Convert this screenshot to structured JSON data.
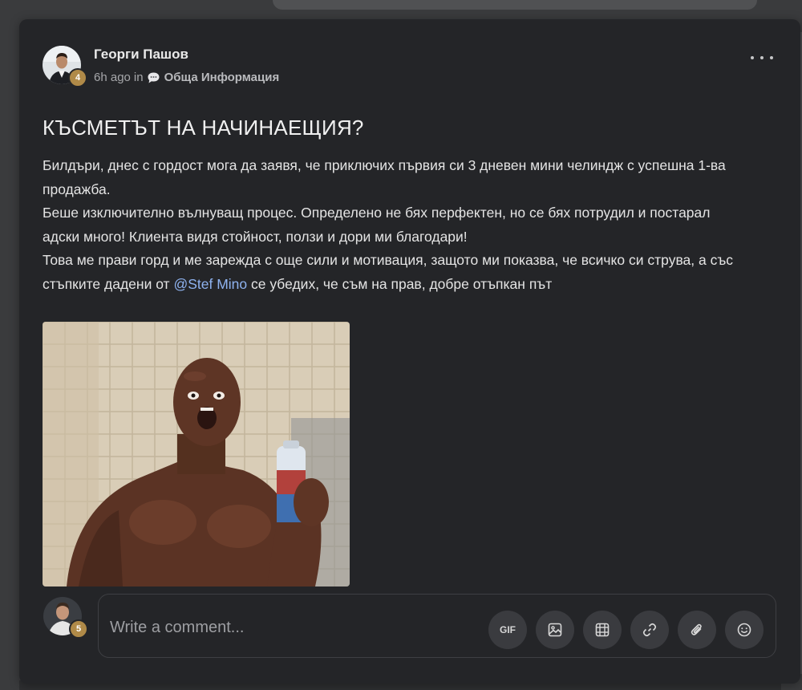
{
  "post": {
    "author": "Георги Пашов",
    "author_level": "4",
    "time_ago": "6h ago",
    "in_word": "in",
    "category": "Обща Информация",
    "title": "КЪСМЕТЪТ НА НАЧИНАЕЩИЯ?",
    "body": {
      "line1": "Билдъри, днес с гордост мога да заявя, че приключих първия си 3 дневен мини челиндж с успешна 1-ва продажба.",
      "line2": "Беше изключително вълнуващ процес. Определено не бях перфектен, но се бях потрудил и постарал адски много! Клиента видя стойност, ползи и дори ми благодари!",
      "line3_before": "Това ме прави горд и ме зарежда с още сили и мотивация, защото ми показва, че всичко си струва, а със стъпките дадени от ",
      "mention": "@Stef Mino",
      "line3_after": " се убедих, че съм на прав, добре отъпкан път"
    },
    "image_icon": "gif-image"
  },
  "comment": {
    "placeholder": "Write a comment...",
    "user_level": "5",
    "gif_label": "GIF",
    "tools": [
      "gif-icon",
      "image-icon",
      "video-icon",
      "link-icon",
      "attachment-icon",
      "emoji-icon"
    ]
  },
  "colors": {
    "background": "#242528",
    "accent_mention": "#8fb3f0",
    "badge": "#b08a48"
  }
}
